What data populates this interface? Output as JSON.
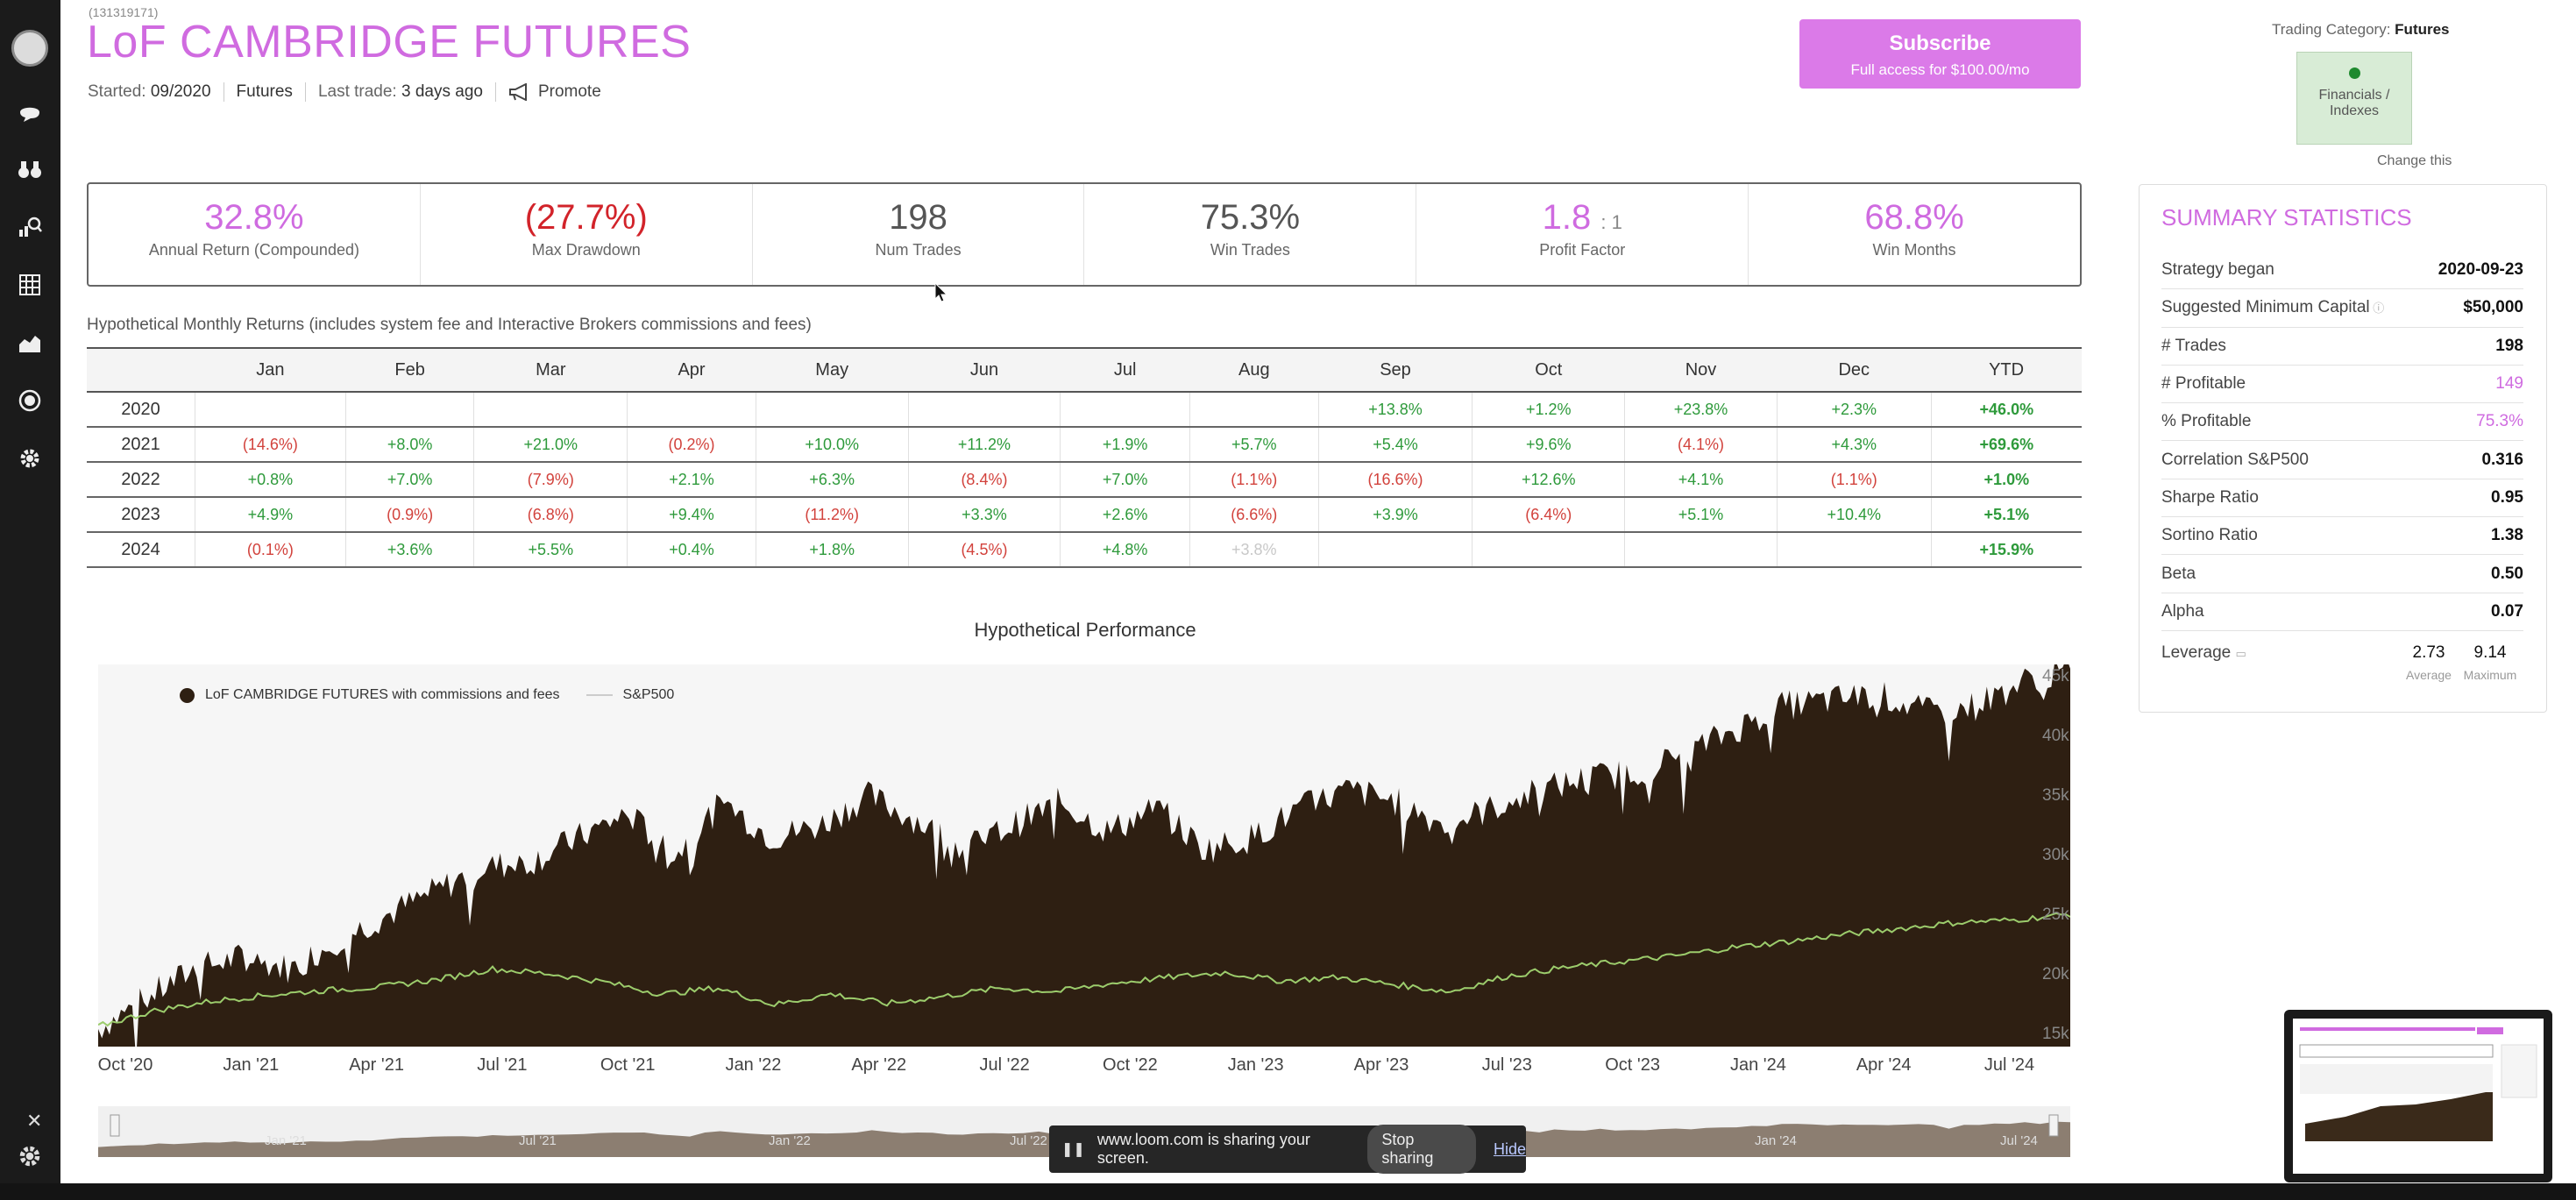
{
  "strategy": {
    "id": "(131319171)",
    "title": "LoF CAMBRIDGE FUTURES",
    "started_label": "Started:",
    "started_value": "09/2020",
    "type": "Futures",
    "last_trade_label": "Last trade:",
    "last_trade_value": "3 days ago",
    "promote_label": "Promote"
  },
  "subscribe": {
    "title": "Subscribe",
    "subtitle": "Full access for $100.00/mo"
  },
  "category": {
    "label": "Trading Category:",
    "value": "Futures",
    "box_label": "Financials / Indexes",
    "change_link": "Change this"
  },
  "stats": [
    {
      "value": "32.8%",
      "label": "Annual Return (Compounded)",
      "color": "purple"
    },
    {
      "value": "(27.7%)",
      "label": "Max Drawdown",
      "color": "red"
    },
    {
      "value": "198",
      "label": "Num Trades",
      "color": "dark"
    },
    {
      "value": "75.3%",
      "label": "Win Trades",
      "color": "dark"
    },
    {
      "value": "1.8",
      "suffix": ": 1",
      "label": "Profit Factor",
      "color": "purple"
    },
    {
      "value": "68.8%",
      "label": "Win Months",
      "color": "purple"
    }
  ],
  "monthly": {
    "caption": "Hypothetical Monthly Returns (includes system fee and Interactive Brokers commissions and fees)",
    "headers": [
      "",
      "Jan",
      "Feb",
      "Mar",
      "Apr",
      "May",
      "Jun",
      "Jul",
      "Aug",
      "Sep",
      "Oct",
      "Nov",
      "Dec",
      "YTD"
    ],
    "rows": [
      [
        "2020",
        "",
        "",
        "",
        "",
        "",
        "",
        "",
        "",
        "+13.8%",
        "+1.2%",
        "+23.8%",
        "+2.3%",
        "+46.0%"
      ],
      [
        "2021",
        "(14.6%)",
        "+8.0%",
        "+21.0%",
        "(0.2%)",
        "+10.0%",
        "+11.2%",
        "+1.9%",
        "+5.7%",
        "+5.4%",
        "+9.6%",
        "(4.1%)",
        "+4.3%",
        "+69.6%"
      ],
      [
        "2022",
        "+0.8%",
        "+7.0%",
        "(7.9%)",
        "+2.1%",
        "+6.3%",
        "(8.4%)",
        "+7.0%",
        "(1.1%)",
        "(16.6%)",
        "+12.6%",
        "+4.1%",
        "(1.1%)",
        "+1.0%"
      ],
      [
        "2023",
        "+4.9%",
        "(0.9%)",
        "(6.8%)",
        "+9.4%",
        "(11.2%)",
        "+3.3%",
        "+2.6%",
        "(6.6%)",
        "+3.9%",
        "(6.4%)",
        "+5.1%",
        "+10.4%",
        "+5.1%"
      ],
      [
        "2024",
        "(0.1%)",
        "+3.6%",
        "+5.5%",
        "+0.4%",
        "+1.8%",
        "(4.5%)",
        "+4.8%",
        "+3.8%",
        "",
        "",
        "",
        "",
        "+15.9%"
      ]
    ]
  },
  "summary": {
    "title": "SUMMARY STATISTICS",
    "rows": [
      {
        "label": "Strategy began",
        "value": "2020-09-23"
      },
      {
        "label": "Suggested Minimum Capital",
        "value": "$50,000"
      },
      {
        "label": "# Trades",
        "value": "198"
      },
      {
        "label": "# Profitable",
        "value": "149",
        "accent": true
      },
      {
        "label": "% Profitable",
        "value": "75.3%",
        "accent": true
      },
      {
        "label": "Correlation S&P500",
        "value": "0.316"
      },
      {
        "label": "Sharpe Ratio",
        "value": "0.95"
      },
      {
        "label": "Sortino Ratio",
        "value": "1.38"
      },
      {
        "label": "Beta",
        "value": "0.50"
      },
      {
        "label": "Alpha",
        "value": "0.07"
      }
    ],
    "leverage": {
      "label": "Leverage",
      "avg": "2.73",
      "avg_label": "Average",
      "max": "9.14",
      "max_label": "Maximum"
    }
  },
  "chart_data": {
    "type": "area",
    "title": "Hypothetical Performance",
    "series": [
      {
        "name": "LoF CAMBRIDGE FUTURES with commissions and fees",
        "color": "#2e1f12",
        "values": [
          15500,
          18000,
          20500,
          21500,
          20500,
          23000,
          25000,
          27000,
          29000,
          29500,
          31500,
          33500,
          30000,
          34500,
          31500,
          32500,
          35000,
          33000,
          30500,
          32500,
          34500,
          32000,
          34000,
          30500,
          31500,
          34000,
          35500,
          34500,
          32500,
          34000,
          35500,
          36500,
          37000,
          38500,
          40500,
          42500,
          43000,
          43500,
          42000,
          42500,
          44500,
          45500
        ]
      },
      {
        "name": "S&P500",
        "color": "#9ccc6c",
        "values": [
          15700,
          17000,
          17800,
          18300,
          18700,
          19000,
          19600,
          20500,
          20100,
          19400,
          18400,
          18900,
          17500,
          18400,
          17600,
          18200,
          18900,
          18600,
          19300,
          19800,
          20200,
          19500,
          19800,
          19200,
          18600,
          19900,
          20600,
          21100,
          21600,
          22300,
          22800,
          23400,
          23900,
          24400,
          24600,
          25100
        ]
      }
    ],
    "x_labels": [
      "Oct '20",
      "Jan '21",
      "Apr '21",
      "Jul '21",
      "Oct '21",
      "Jan '22",
      "Apr '22",
      "Jul '22",
      "Oct '22",
      "Jan '23",
      "Apr '23",
      "Jul '23",
      "Oct '23",
      "Jan '24",
      "Apr '24",
      "Jul '24"
    ],
    "y_labels": [
      "45k",
      "40k",
      "35k",
      "30k",
      "25k",
      "20k",
      "15k"
    ],
    "ylim": [
      14000,
      46000
    ],
    "legend": "top-left",
    "grid": false
  },
  "navigator": {
    "labels": [
      "Jan '21",
      "Jul '21",
      "Jan '22",
      "Jul '22",
      "Jan '24",
      "Jul '24"
    ]
  },
  "loom": {
    "text": "www.loom.com is sharing your screen.",
    "stop": "Stop sharing",
    "hide": "Hide"
  }
}
